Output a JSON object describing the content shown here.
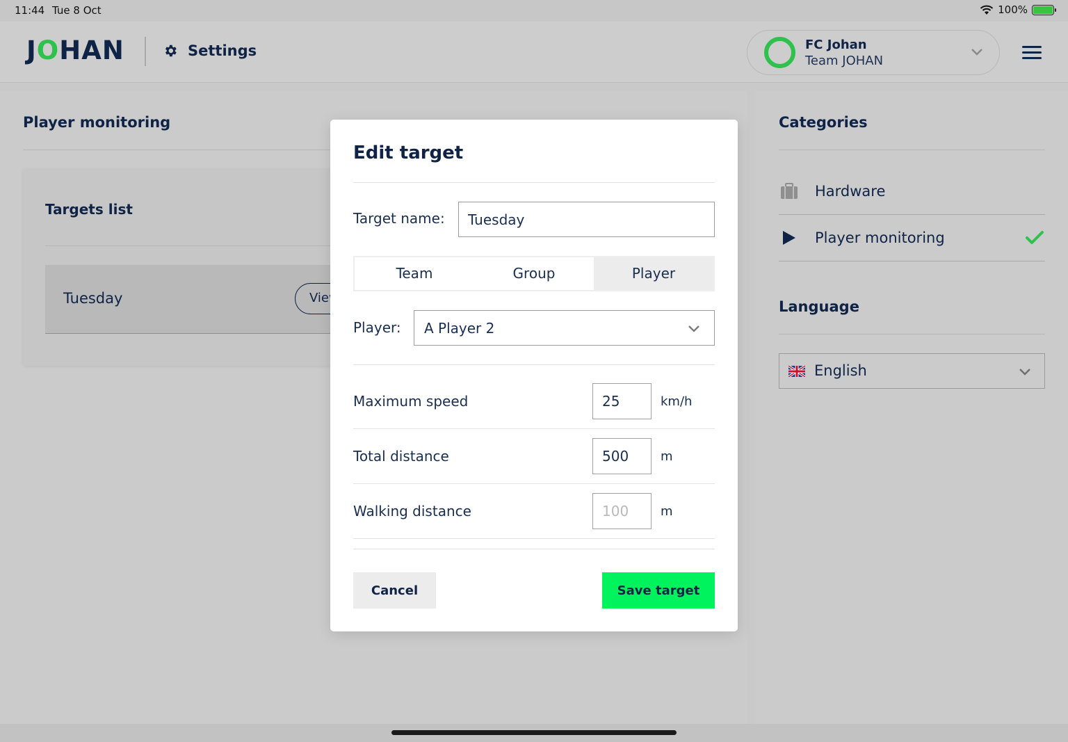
{
  "status_bar": {
    "time": "11:44",
    "date": "Tue 8 Oct",
    "battery": "100%"
  },
  "header": {
    "logo_prefix": "J",
    "logo_o": "O",
    "logo_suffix": "HAN",
    "section": "Settings",
    "club_name": "FC Johan",
    "team_name": "Team JOHAN"
  },
  "player_monitoring": {
    "title": "Player monitoring",
    "targets_title": "Targets list",
    "targets": [
      {
        "name": "Tuesday",
        "view_label": "View"
      }
    ]
  },
  "categories": {
    "title": "Categories",
    "items": [
      {
        "label": "Hardware",
        "icon": "briefcase-icon",
        "selected": false
      },
      {
        "label": "Player monitoring",
        "icon": "play-icon",
        "selected": true
      }
    ],
    "language_title": "Language",
    "language_value": "English"
  },
  "modal": {
    "title": "Edit target",
    "target_name_label": "Target name:",
    "target_name_value": "Tuesday",
    "tabs": [
      "Team",
      "Group",
      "Player"
    ],
    "active_tab": "Player",
    "player_label": "Player:",
    "player_value": "A Player 2",
    "metrics": [
      {
        "label": "Maximum speed",
        "value": "25",
        "placeholder": "",
        "unit": "km/h"
      },
      {
        "label": "Total distance",
        "value": "500",
        "placeholder": "",
        "unit": "m"
      },
      {
        "label": "Walking distance",
        "value": "",
        "placeholder": "100",
        "unit": "m"
      }
    ],
    "cancel_label": "Cancel",
    "save_label": "Save target"
  },
  "colors": {
    "accent_green": "#00f25d",
    "brand_green": "#2ec14b",
    "navy": "#0f2346"
  }
}
